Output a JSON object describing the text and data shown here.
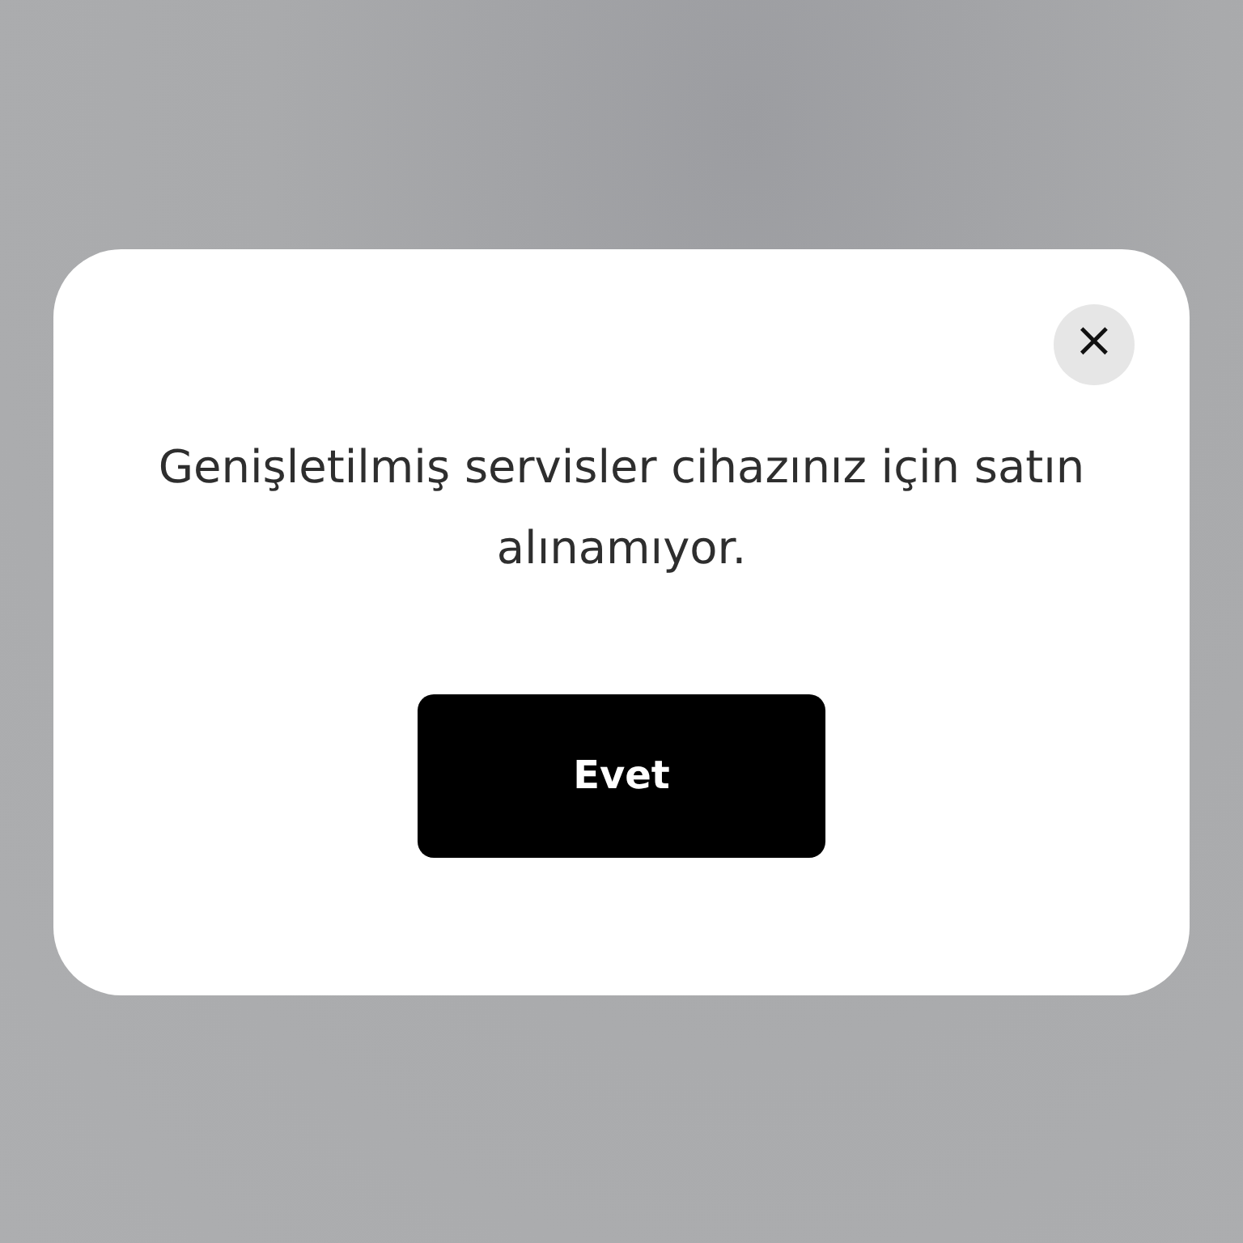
{
  "dialog": {
    "close": "×",
    "message": "Genişletilmiş servisler cihazınız için satın alınamıyor.",
    "button": "Evet"
  }
}
